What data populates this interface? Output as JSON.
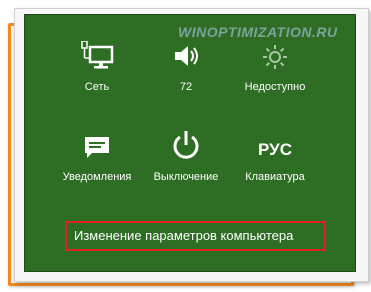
{
  "watermark": "WINOPTIMIZATION.RU",
  "tiles": [
    {
      "label": "Сеть",
      "icon": "network-icon"
    },
    {
      "label": "72",
      "icon": "volume-icon"
    },
    {
      "label": "Недоступно",
      "icon": "brightness-icon"
    },
    {
      "label": "Уведомления",
      "icon": "notifications-icon"
    },
    {
      "label": "Выключение",
      "icon": "power-icon"
    },
    {
      "label": "Клавиатура",
      "icon": "keyboard-language-icon",
      "glyph": "РУС"
    }
  ],
  "settings_link": "Изменение параметров компьютера",
  "colors": {
    "panel": "#2e6e24",
    "highlight": "#e02222",
    "frame": "#f08a1c"
  }
}
